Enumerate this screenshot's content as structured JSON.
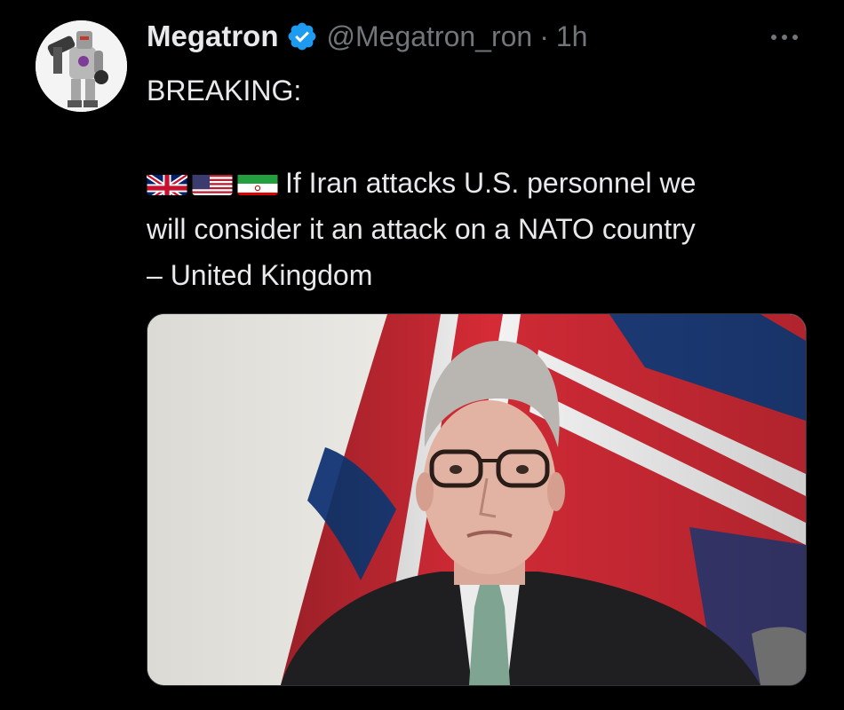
{
  "author": {
    "name": "Megatron",
    "handle": "@Megatron_ron",
    "separator": "·",
    "time": "1h",
    "verified": true
  },
  "tweet": {
    "line1": "BREAKING:",
    "flags": [
      "flag-uk-icon",
      "flag-us-icon",
      "flag-iran-icon"
    ],
    "line2": "If Iran attacks U.S. personnel we",
    "line3": "will consider it an attack on a NATO country",
    "line4": "– United Kingdom"
  },
  "colors": {
    "background": "#000000",
    "text": "#e7e9ea",
    "secondary": "#71767b",
    "verified_blue": "#1d9bf0"
  },
  "icons": {
    "more": "more-horizontal-icon",
    "verified": "verified-badge-icon"
  }
}
